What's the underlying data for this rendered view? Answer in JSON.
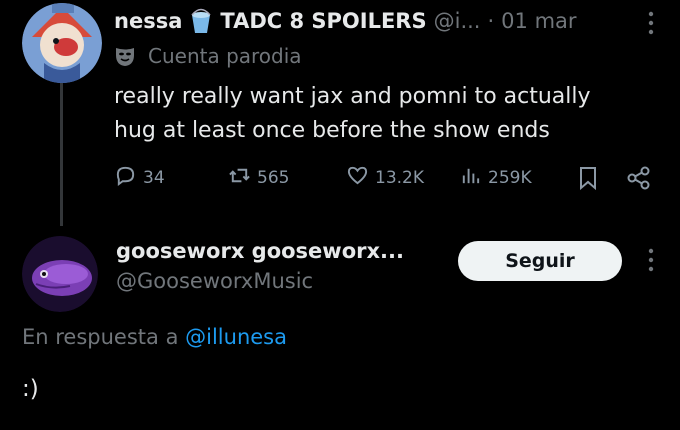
{
  "tweet": {
    "author_name": "nessa",
    "author_name2": "TADC 8 SPOILERS",
    "handle": "@i...",
    "dot": "·",
    "date": "01 mar",
    "parody_label": "Cuenta parodia",
    "text_line1": "really really want jax and pomni to actually",
    "text_line2": "hug at least once before the show ends",
    "stats": {
      "replies": "34",
      "reposts": "565",
      "likes": "13.2K",
      "views": "259K"
    }
  },
  "reply_author": {
    "name": "gooseworx gooseworx...",
    "handle": "@GooseworxMusic",
    "follow_label": "Seguir"
  },
  "reply_context": {
    "prefix": "En respuesta a",
    "mention": "@illunesa"
  },
  "reply_text": ":)",
  "icons": [
    "bucket-icon",
    "mask-icon",
    "more-icon",
    "reply-icon",
    "repost-icon",
    "like-icon",
    "views-icon",
    "bookmark-icon",
    "share-icon"
  ],
  "colors": {
    "background": "#000000",
    "text": "#e7e9ea",
    "secondary": "#71767b",
    "link": "#1d9bf0",
    "button": "#eff3f4"
  }
}
